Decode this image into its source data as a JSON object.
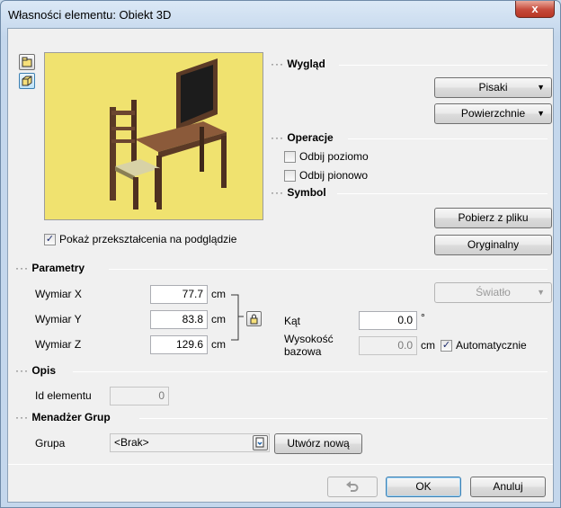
{
  "window": {
    "title": "Własności elementu: Obiekt 3D",
    "close": "x"
  },
  "preview": {
    "show_transforms": "Pokaż przekształcenia na podglądzie",
    "show_transforms_checked": true
  },
  "wyglad": {
    "title": "Wygląd",
    "pens": "Pisaki",
    "surfaces": "Powierzchnie"
  },
  "operacje": {
    "title": "Operacje",
    "flip_h": "Odbij poziomo",
    "flip_h_checked": false,
    "flip_v": "Odbij pionowo",
    "flip_v_checked": false
  },
  "symbol": {
    "title": "Symbol",
    "load": "Pobierz z pliku",
    "original": "Oryginalny"
  },
  "parametry": {
    "title": "Parametry",
    "x_label": "Wymiar X",
    "x_value": "77.7",
    "y_label": "Wymiar Y",
    "y_value": "83.8",
    "z_label": "Wymiar Z",
    "z_value": "129.6",
    "unit_cm": "cm",
    "light": "Światło",
    "angle_label": "Kąt",
    "angle_value": "0.0",
    "angle_unit": "°",
    "base_height_label_1": "Wysokość",
    "base_height_label_2": "bazowa",
    "base_height_value": "0.0",
    "auto_label": "Automatycznie",
    "auto_checked": true
  },
  "opis": {
    "title": "Opis",
    "id_label": "Id elementu",
    "id_value": "0"
  },
  "groups": {
    "title": "Menadżer Grup",
    "group_label": "Grupa",
    "group_value": "<Brak>",
    "create": "Utwórz nową"
  },
  "footer": {
    "ok": "OK",
    "cancel": "Anuluj"
  },
  "colors": {
    "preview_bg": "#f0e26f",
    "close_red": "#c5493a"
  }
}
